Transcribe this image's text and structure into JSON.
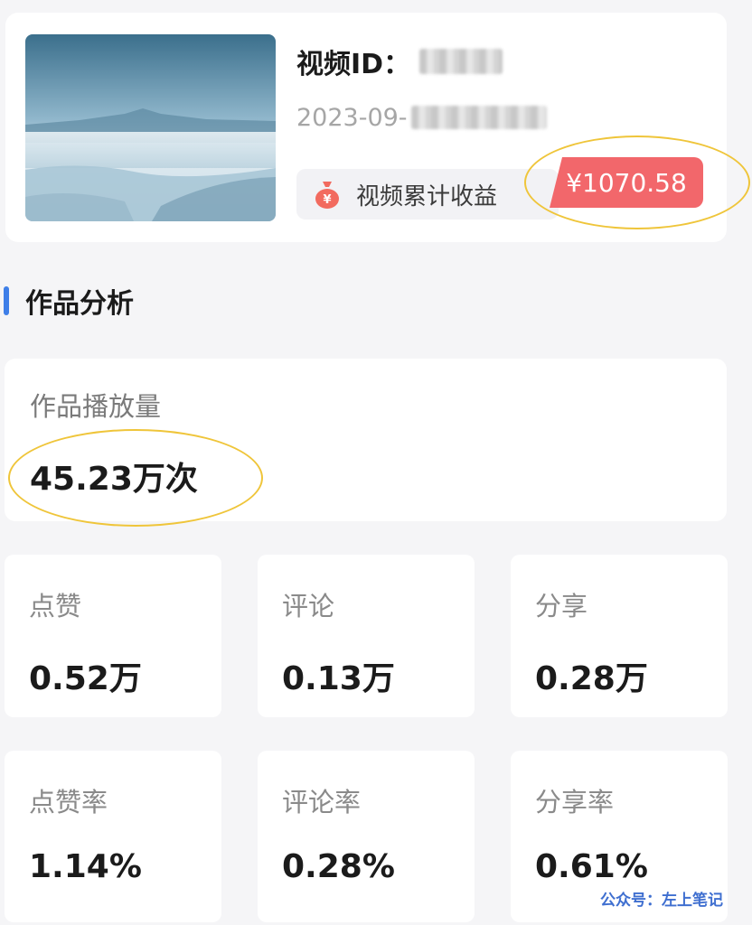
{
  "video": {
    "id_label": "视频ID：",
    "date_prefix": "2023-09-",
    "revenue_label": "视频累计收益",
    "revenue_amount": "¥1070.58",
    "revenue_icon": "money-bag-icon"
  },
  "section": {
    "title": "作品分析"
  },
  "plays": {
    "label": "作品播放量",
    "value": "45.23万次"
  },
  "stats": [
    {
      "label": "点赞",
      "value": "0.52万"
    },
    {
      "label": "评论",
      "value": "0.13万"
    },
    {
      "label": "分享",
      "value": "0.28万"
    },
    {
      "label": "点赞率",
      "value": "1.14%"
    },
    {
      "label": "评论率",
      "value": "0.28%"
    },
    {
      "label": "分享率",
      "value": "0.61%"
    }
  ],
  "watermark": "公众号：左上笔记",
  "colors": {
    "accent_blue": "#3f7fe8",
    "revenue_red": "#f2676b",
    "highlight_yellow": "#efc53a"
  }
}
